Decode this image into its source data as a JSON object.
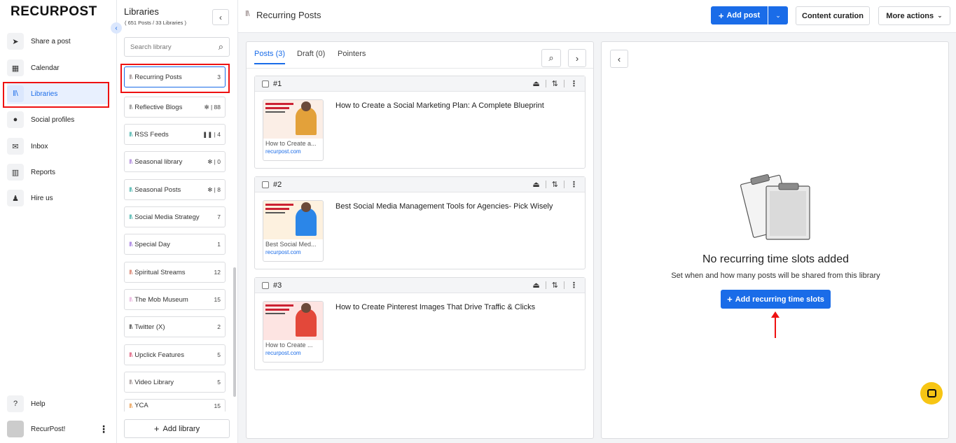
{
  "brand": {
    "logo": "RECURPOST"
  },
  "nav": {
    "items": [
      {
        "label": "Share a post",
        "icon": "send-icon"
      },
      {
        "label": "Calendar",
        "icon": "calendar-icon"
      },
      {
        "label": "Libraries",
        "icon": "libraries-icon"
      },
      {
        "label": "Social profiles",
        "icon": "user-circle-icon"
      },
      {
        "label": "Inbox",
        "icon": "inbox-icon"
      },
      {
        "label": "Reports",
        "icon": "reports-icon"
      },
      {
        "label": "Hire us",
        "icon": "person-icon"
      }
    ],
    "help": "Help",
    "account": "RecurPost!"
  },
  "libraries": {
    "title": "Libraries",
    "subtitle": "( 651 Posts / 33 Libraries )",
    "search_placeholder": "Search library",
    "items": [
      {
        "name": "Recurring Posts",
        "count": "3",
        "color": "#8a7a7a"
      },
      {
        "name": "Reflective Blogs",
        "count": "88",
        "color": "#777777"
      },
      {
        "name": "RSS Feeds",
        "count": "4",
        "color": "#21a39a"
      },
      {
        "name": "Seasonal library",
        "count": "0",
        "color": "#9b6bd3"
      },
      {
        "name": "Seasonal Posts",
        "count": "8",
        "color": "#21a39a"
      },
      {
        "name": "Social Media Strategy",
        "count": "7",
        "color": "#21a39a"
      },
      {
        "name": "Special Day",
        "count": "1",
        "color": "#8e5cd9"
      },
      {
        "name": "Spiritual Streams",
        "count": "12",
        "color": "#d0624a"
      },
      {
        "name": "The Mob Museum",
        "count": "15",
        "color": "#e3a1d5"
      },
      {
        "name": "Twitter (X)",
        "count": "2",
        "color": "#222222"
      },
      {
        "name": "Upclick Features",
        "count": "5",
        "color": "#d9365e"
      },
      {
        "name": "Video Library",
        "count": "5",
        "color": "#8a7a7a"
      },
      {
        "name": "YCA",
        "count": "15",
        "color": "#e58a2e"
      }
    ],
    "add_label": "Add library"
  },
  "header": {
    "title": "Recurring Posts",
    "add_post": "Add post",
    "content_curation": "Content curation",
    "more_actions": "More actions"
  },
  "tabs": [
    {
      "label": "Posts (3)"
    },
    {
      "label": "Draft (0)"
    },
    {
      "label": "Pointers"
    }
  ],
  "posts": [
    {
      "num": "#1",
      "title": "How to Create a Social Marketing Plan: A Complete Blueprint",
      "thumb_title": "How to Create a...",
      "domain": "recurpost.com",
      "thumb_bg": "#fbeee6",
      "accent": "#e3a13a"
    },
    {
      "num": "#2",
      "title": "Best Social Media Management Tools for Agencies- Pick Wisely",
      "thumb_title": "Best Social Med...",
      "domain": "recurpost.com",
      "thumb_bg": "#fdf1df",
      "accent": "#2b86e8"
    },
    {
      "num": "#3",
      "title": "How to Create Pinterest Images That Drive Traffic & Clicks",
      "thumb_title": "How to Create ...",
      "domain": "recurpost.com",
      "thumb_bg": "#fde4e2",
      "accent": "#e3483a"
    }
  ],
  "empty": {
    "title": "No recurring time slots added",
    "text": "Set when and how many posts will be shared from this library",
    "button": "Add recurring time slots"
  },
  "colors": {
    "primary": "#1a6ce8",
    "highlight": "#e11111"
  }
}
